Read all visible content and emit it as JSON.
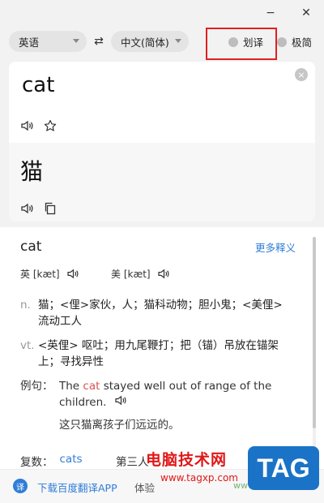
{
  "window": {
    "minimize": "−",
    "close": "✕"
  },
  "langbar": {
    "source": "英语",
    "target": "中文(简体)",
    "swap": "⇄",
    "toggle_huayi": "划译",
    "toggle_jijian": "极简"
  },
  "input": {
    "text": "cat",
    "clear": "×"
  },
  "output": {
    "text": "猫"
  },
  "detail": {
    "headword": "cat",
    "more": "更多释义",
    "phonetic_uk": "英 [kæt]",
    "phonetic_us": "美 [kæt]",
    "senses": [
      {
        "pos": "n.",
        "def": "猫；<俚>家伙，人；猫科动物；胆小鬼；<美俚> 流动工人"
      },
      {
        "pos": "vt.",
        "def": "<英俚> 呕吐；用九尾鞭打；把（锚）吊放在锚架上；寻找异性"
      }
    ],
    "example": {
      "label": "例句：",
      "en_before": "The ",
      "en_hl": "cat",
      "en_after": " stayed well out of range of the children.",
      "zh": "这只猫离孩子们远远的。"
    },
    "plural_label": "复数：",
    "plural_value": "cats",
    "next_label": "第三人"
  },
  "footer": {
    "logo": "译",
    "download": "下载百度翻译APP",
    "text": "体验",
    "menu": "☰"
  },
  "watermark": {
    "title": "电脑技术网",
    "url": "www.tagxp.com",
    "badge": "TAG",
    "url2": "www.xz7.com"
  },
  "colors": {
    "accent": "#2f7ed8",
    "highlight_box": "#e02020",
    "example_highlight": "#d9534f"
  },
  "icons": [
    "minimize-icon",
    "close-icon",
    "swap-icon",
    "clear-icon",
    "speaker-icon",
    "star-icon",
    "copy-icon",
    "menu-icon"
  ]
}
